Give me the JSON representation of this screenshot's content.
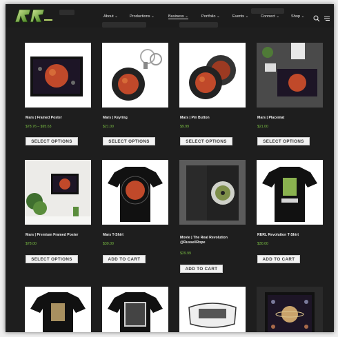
{
  "header": {
    "logo_alt": "RR",
    "nav": [
      {
        "label": "About",
        "chev": "⌄"
      },
      {
        "label": "Productions",
        "chev": "⌄"
      },
      {
        "label": "Business",
        "chev": "⌄"
      },
      {
        "label": "Portfolio",
        "chev": "⌄"
      },
      {
        "label": "Events",
        "chev": "⌄"
      },
      {
        "label": "Connect",
        "chev": "⌄"
      },
      {
        "label": "Shop",
        "chev": "⌄"
      }
    ],
    "icons": [
      "search-icon",
      "menu-icon"
    ]
  },
  "products": [
    {
      "title": "Mars | Framed Poster",
      "price": "$78.76 – $95.63",
      "button": "SELECT OPTIONS"
    },
    {
      "title": "Mars | Keyring",
      "price": "$21.00",
      "button": "SELECT OPTIONS"
    },
    {
      "title": "Mars | Pin Button",
      "price": "$9.99",
      "button": "SELECT OPTIONS"
    },
    {
      "title": "Mars | Placemat",
      "price": "$21.00",
      "button": "SELECT OPTIONS"
    },
    {
      "title": "Mars | Premium Framed Poster",
      "price": "$78.00",
      "button": "SELECT OPTIONS"
    },
    {
      "title": "Mars T-Shirt",
      "price": "$30.00",
      "button": "ADD TO CART"
    },
    {
      "title": "Movie | The Real Revolution @RussellRope",
      "price": "$29.99",
      "button": "ADD TO CART"
    },
    {
      "title": "RERL Revolution T-Shirt",
      "price": "$30.00",
      "button": "ADD TO CART"
    }
  ],
  "colors": {
    "bg": "#1e1e1e",
    "price": "#7bc043",
    "accent": "#2f6a1b"
  }
}
